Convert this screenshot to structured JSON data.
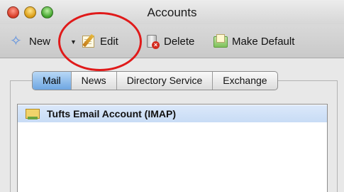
{
  "window": {
    "title": "Accounts"
  },
  "toolbar": {
    "new_label": "New",
    "edit_label": "Edit",
    "delete_label": "Delete",
    "make_default_label": "Make Default"
  },
  "tabs": [
    {
      "label": "Mail",
      "selected": true
    },
    {
      "label": "News",
      "selected": false
    },
    {
      "label": "Directory Service",
      "selected": false
    },
    {
      "label": "Exchange",
      "selected": false
    }
  ],
  "accounts": [
    {
      "label": "Tufts Email Account (IMAP)",
      "selected": true
    }
  ],
  "colors": {
    "annotation": "#e01a1a",
    "selection": "#c8dcf5",
    "active_tab": "#6ea6e2"
  },
  "icons": {
    "new": "star-icon",
    "edit": "edit-icon",
    "delete": "trash-icon",
    "make_default": "make-default-icon",
    "account": "mail-account-icon"
  }
}
